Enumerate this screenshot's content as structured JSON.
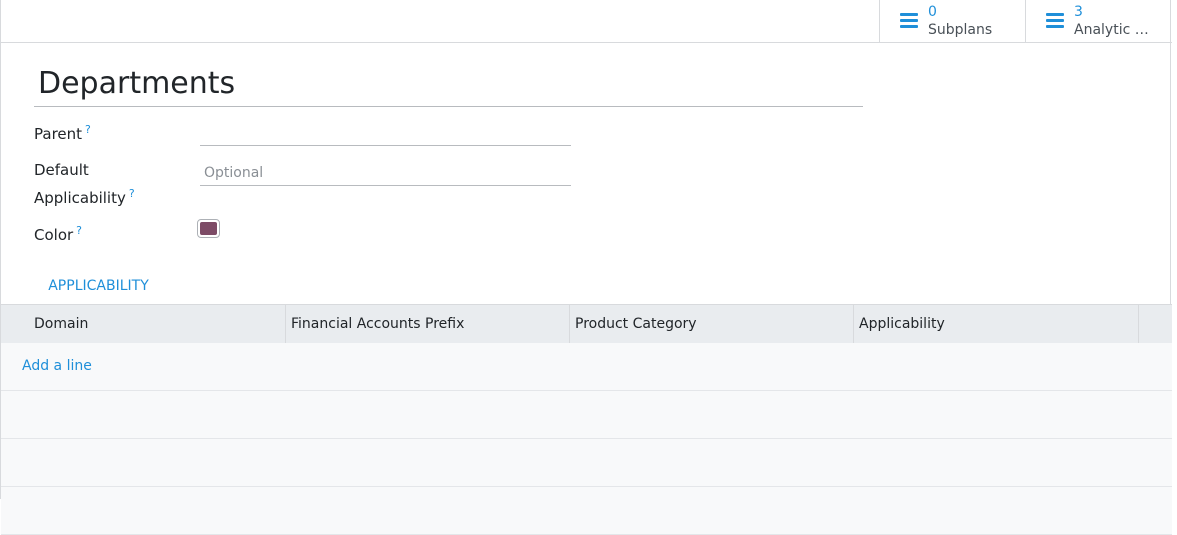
{
  "stat_buttons": {
    "subplans": {
      "value": "0",
      "label": "Subplans",
      "icon": "list-icon"
    },
    "analytic_accounts": {
      "value": "3",
      "label": "Analytic A...",
      "icon": "list-icon"
    }
  },
  "form": {
    "title": "Departments",
    "parent_label": "Parent",
    "help_mark": "?",
    "default_applicability_label_line1": "Default",
    "default_applicability_label_line2": "Applicability",
    "default_applicability_placeholder": "Optional",
    "color_label": "Color",
    "color_value": "#7d4b66"
  },
  "tabs": [
    {
      "label": "APPLICABILITY",
      "active": true
    }
  ],
  "table": {
    "columns": [
      "Domain",
      "Financial Accounts Prefix",
      "Product Category",
      "Applicability"
    ],
    "add_line_label": "Add a line"
  },
  "colors": {
    "accent": "#1f8fd9",
    "header_bg": "#e9ecef",
    "row_bg": "#f8f9fa"
  }
}
